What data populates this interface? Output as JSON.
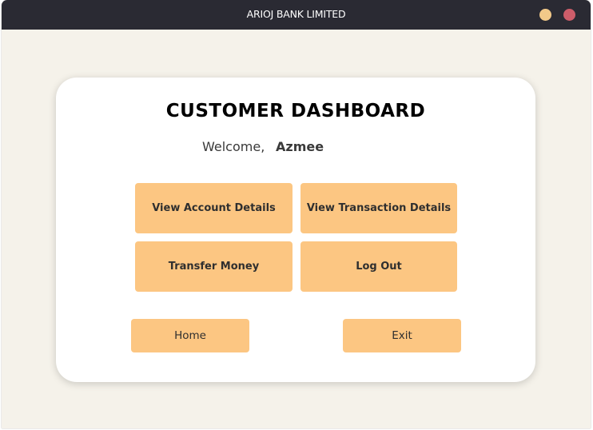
{
  "window": {
    "title": "ARIOJ BANK LIMITED"
  },
  "colors": {
    "titlebar": "#2a2a33",
    "window_bg": "#f5f2ea",
    "card_bg": "#ffffff",
    "button_bg": "#fcc682",
    "minimize": "#f2c989",
    "close": "#cd5d6a"
  },
  "dashboard": {
    "title": "CUSTOMER DASHBOARD",
    "welcome_label": "Welcome,",
    "username": "Azmee"
  },
  "actions": {
    "view_account": "View Account Details",
    "view_transactions": "View Transaction Details",
    "transfer_money": "Transfer Money",
    "log_out": "Log Out"
  },
  "footer": {
    "home": "Home",
    "exit": "Exit"
  }
}
